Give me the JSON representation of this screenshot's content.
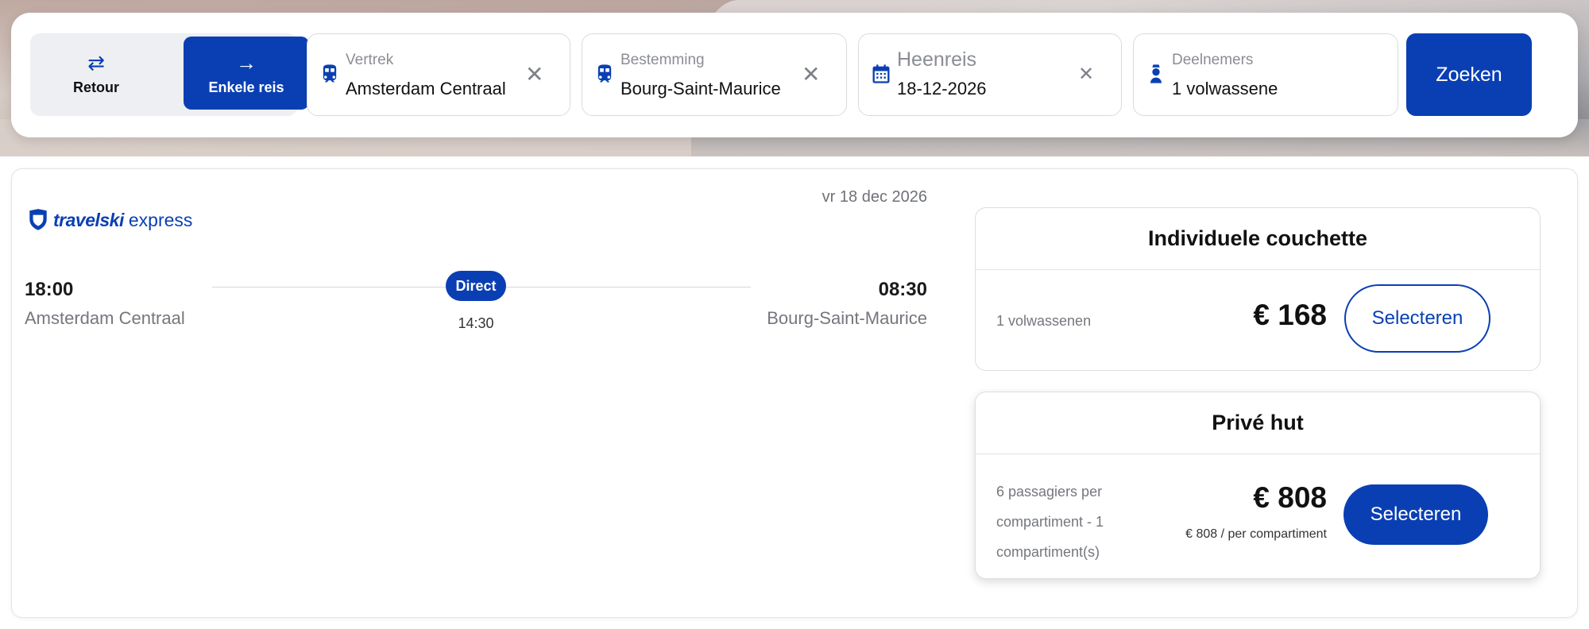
{
  "search": {
    "trip_types": [
      {
        "label": "Retour",
        "icon": "repeat-icon",
        "active": false
      },
      {
        "label": "Enkele reis",
        "icon": "arrow-right-icon",
        "active": true
      }
    ],
    "departure": {
      "label": "Vertrek",
      "value": "Amsterdam Centraal",
      "icon": "train-icon"
    },
    "destination": {
      "label": "Bestemming",
      "value": "Bourg-Saint-Maurice",
      "icon": "train-icon"
    },
    "outbound": {
      "label": "Heenreis",
      "value": "18-12-2026",
      "icon": "calendar-icon"
    },
    "participants": {
      "label": "Deelnemers",
      "value": "1 volwassene",
      "icon": "person-icon"
    },
    "submit_label": "Zoeken",
    "clear_glyph": "✕"
  },
  "result": {
    "operator": {
      "bold": "travelski",
      "light": "express"
    },
    "date": "vr 18 dec 2026",
    "departure_time": "18:00",
    "departure_station": "Amsterdam Centraal",
    "arrival_time": "08:30",
    "arrival_station": "Bourg-Saint-Maurice",
    "badge": "Direct",
    "duration": "14:30",
    "offers": [
      {
        "title": "Individuele couchette",
        "description": "1 volwassenen",
        "price": "€ 168",
        "button": "Selecteren"
      },
      {
        "title": "Privé hut",
        "description": "6 passagiers per compartiment - 1 compartiment(s)",
        "price": "€ 808",
        "price_note": "€ 808 / per compartiment",
        "button": "Selecteren"
      }
    ]
  },
  "colors": {
    "brand": "#0a3fb4",
    "muted": "#74777d",
    "border": "#dcdde1"
  }
}
